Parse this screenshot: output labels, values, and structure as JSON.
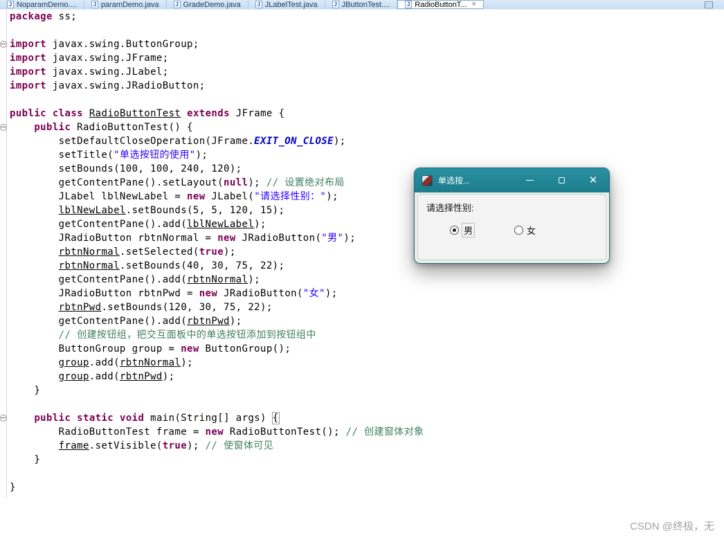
{
  "tab_bar": {
    "close_glyph": "×",
    "tabs": [
      {
        "label": "NoparamDemo....",
        "active": false
      },
      {
        "label": "paramDemo.java",
        "active": false
      },
      {
        "label": "GradeDemo.java",
        "active": false
      },
      {
        "label": "JLabelTest.java",
        "active": false
      },
      {
        "label": "JButtonTest....",
        "active": false
      },
      {
        "label": "RadioButtonT...",
        "active": true
      }
    ]
  },
  "colors": {
    "keyword": "#7b0052",
    "string": "#2a00ff",
    "comment": "#3f7f5f",
    "static_field": "#0000c0",
    "titlebar": "#1f8494",
    "tab_bar_bg": "#d6e7f7"
  },
  "editor": {
    "lines": [
      {
        "tokens": [
          [
            "kw",
            "package"
          ],
          [
            "pl",
            " ss;"
          ]
        ]
      },
      {
        "tokens": []
      },
      {
        "fold": true,
        "tokens": [
          [
            "kw",
            "import"
          ],
          [
            "pl",
            " javax.swing.ButtonGroup;"
          ]
        ]
      },
      {
        "tokens": [
          [
            "kw",
            "import"
          ],
          [
            "pl",
            " javax.swing.JFrame;"
          ]
        ]
      },
      {
        "tokens": [
          [
            "kw",
            "import"
          ],
          [
            "pl",
            " javax.swing.JLabel;"
          ]
        ]
      },
      {
        "tokens": [
          [
            "kw",
            "import"
          ],
          [
            "pl",
            " javax.swing.JRadioButton;"
          ]
        ]
      },
      {
        "tokens": []
      },
      {
        "tokens": [
          [
            "kw",
            "public"
          ],
          [
            "pl",
            " "
          ],
          [
            "kw",
            "class"
          ],
          [
            "pl",
            " "
          ],
          [
            "decl",
            "RadioButtonTest"
          ],
          [
            "pl",
            " "
          ],
          [
            "kw",
            "extends"
          ],
          [
            "pl",
            " JFrame {"
          ]
        ]
      },
      {
        "fold": true,
        "tokens": [
          [
            "pl",
            "    "
          ],
          [
            "kw",
            "public"
          ],
          [
            "pl",
            " RadioButtonTest() {"
          ]
        ]
      },
      {
        "tokens": [
          [
            "pl",
            "        setDefaultCloseOperation(JFrame."
          ],
          [
            "field",
            "EXIT_ON_CLOSE"
          ],
          [
            "pl",
            ");"
          ]
        ]
      },
      {
        "tokens": [
          [
            "pl",
            "        setTitle("
          ],
          [
            "str",
            "\"单选按钮的使用\""
          ],
          [
            "pl",
            ");"
          ]
        ]
      },
      {
        "tokens": [
          [
            "pl",
            "        setBounds(100, 100, 240, 120);"
          ]
        ]
      },
      {
        "tokens": [
          [
            "pl",
            "        getContentPane().setLayout("
          ],
          [
            "kw",
            "null"
          ],
          [
            "pl",
            "); "
          ],
          [
            "com",
            "// 设置绝对布局"
          ]
        ]
      },
      {
        "tokens": [
          [
            "pl",
            "        JLabel lblNewLabel = "
          ],
          [
            "kw",
            "new"
          ],
          [
            "pl",
            " JLabel("
          ],
          [
            "str",
            "\"请选择性别：\""
          ],
          [
            "pl",
            ");"
          ]
        ]
      },
      {
        "tokens": [
          [
            "pl",
            "        "
          ],
          [
            "var",
            "lblNewLabel"
          ],
          [
            "pl",
            ".setBounds(5, 5, 120, 15);"
          ]
        ]
      },
      {
        "tokens": [
          [
            "pl",
            "        getContentPane().add("
          ],
          [
            "var",
            "lblNewLabel"
          ],
          [
            "pl",
            ");"
          ]
        ]
      },
      {
        "tokens": [
          [
            "pl",
            "        JRadioButton rbtnNormal = "
          ],
          [
            "kw",
            "new"
          ],
          [
            "pl",
            " JRadioButton("
          ],
          [
            "str",
            "\"男\""
          ],
          [
            "pl",
            ");"
          ]
        ]
      },
      {
        "tokens": [
          [
            "pl",
            "        "
          ],
          [
            "var",
            "rbtnNormal"
          ],
          [
            "pl",
            ".setSelected("
          ],
          [
            "kw",
            "true"
          ],
          [
            "pl",
            ");"
          ]
        ]
      },
      {
        "tokens": [
          [
            "pl",
            "        "
          ],
          [
            "var",
            "rbtnNormal"
          ],
          [
            "pl",
            ".setBounds(40, 30, 75, 22);"
          ]
        ]
      },
      {
        "tokens": [
          [
            "pl",
            "        getContentPane().add("
          ],
          [
            "var",
            "rbtnNormal"
          ],
          [
            "pl",
            ");"
          ]
        ]
      },
      {
        "tokens": [
          [
            "pl",
            "        JRadioButton rbtnPwd = "
          ],
          [
            "kw",
            "new"
          ],
          [
            "pl",
            " JRadioButton("
          ],
          [
            "str",
            "\"女\""
          ],
          [
            "pl",
            ");"
          ]
        ]
      },
      {
        "tokens": [
          [
            "pl",
            "        "
          ],
          [
            "var",
            "rbtnPwd"
          ],
          [
            "pl",
            ".setBounds(120, 30, 75, 22);"
          ]
        ]
      },
      {
        "tokens": [
          [
            "pl",
            "        getContentPane().add("
          ],
          [
            "var",
            "rbtnPwd"
          ],
          [
            "pl",
            ");"
          ]
        ]
      },
      {
        "tokens": [
          [
            "pl",
            "        "
          ],
          [
            "com",
            "// 创建按钮组，把交互面板中的单选按钮添加到按钮组中"
          ]
        ]
      },
      {
        "tokens": [
          [
            "pl",
            "        ButtonGroup group = "
          ],
          [
            "kw",
            "new"
          ],
          [
            "pl",
            " ButtonGroup();"
          ]
        ]
      },
      {
        "tokens": [
          [
            "pl",
            "        "
          ],
          [
            "var",
            "group"
          ],
          [
            "pl",
            ".add("
          ],
          [
            "var",
            "rbtnNormal"
          ],
          [
            "pl",
            ");"
          ]
        ]
      },
      {
        "tokens": [
          [
            "pl",
            "        "
          ],
          [
            "var",
            "group"
          ],
          [
            "pl",
            ".add("
          ],
          [
            "var",
            "rbtnPwd"
          ],
          [
            "pl",
            ");"
          ]
        ]
      },
      {
        "tokens": [
          [
            "pl",
            "    }"
          ]
        ]
      },
      {
        "tokens": []
      },
      {
        "fold": true,
        "tokens": [
          [
            "pl",
            "    "
          ],
          [
            "kw",
            "public"
          ],
          [
            "pl",
            " "
          ],
          [
            "kw",
            "static"
          ],
          [
            "pl",
            " "
          ],
          [
            "kw",
            "void"
          ],
          [
            "pl",
            " main(String[] args) "
          ],
          [
            "box",
            "{"
          ]
        ]
      },
      {
        "tokens": [
          [
            "pl",
            "        RadioButtonTest frame = "
          ],
          [
            "kw",
            "new"
          ],
          [
            "pl",
            " RadioButtonTest(); "
          ],
          [
            "com",
            "// 创建窗体对象"
          ]
        ]
      },
      {
        "tokens": [
          [
            "pl",
            "        "
          ],
          [
            "var",
            "frame"
          ],
          [
            "pl",
            ".setVisible("
          ],
          [
            "kw",
            "true"
          ],
          [
            "pl",
            "); "
          ],
          [
            "com",
            "// 使窗体可见"
          ]
        ]
      },
      {
        "tokens": [
          [
            "pl",
            "    }"
          ]
        ]
      },
      {
        "tokens": []
      },
      {
        "tokens": [
          [
            "pl",
            "}"
          ]
        ]
      }
    ]
  },
  "dialog": {
    "title": "单选按...",
    "controls": {
      "minimize": "minimize",
      "maximize": "maximize",
      "close": "✕"
    },
    "label": "请选择性别:",
    "radios": [
      {
        "label": "男",
        "selected": true,
        "focused": true
      },
      {
        "label": "女",
        "selected": false,
        "focused": false
      }
    ]
  },
  "watermark": "CSDN @终极，无"
}
